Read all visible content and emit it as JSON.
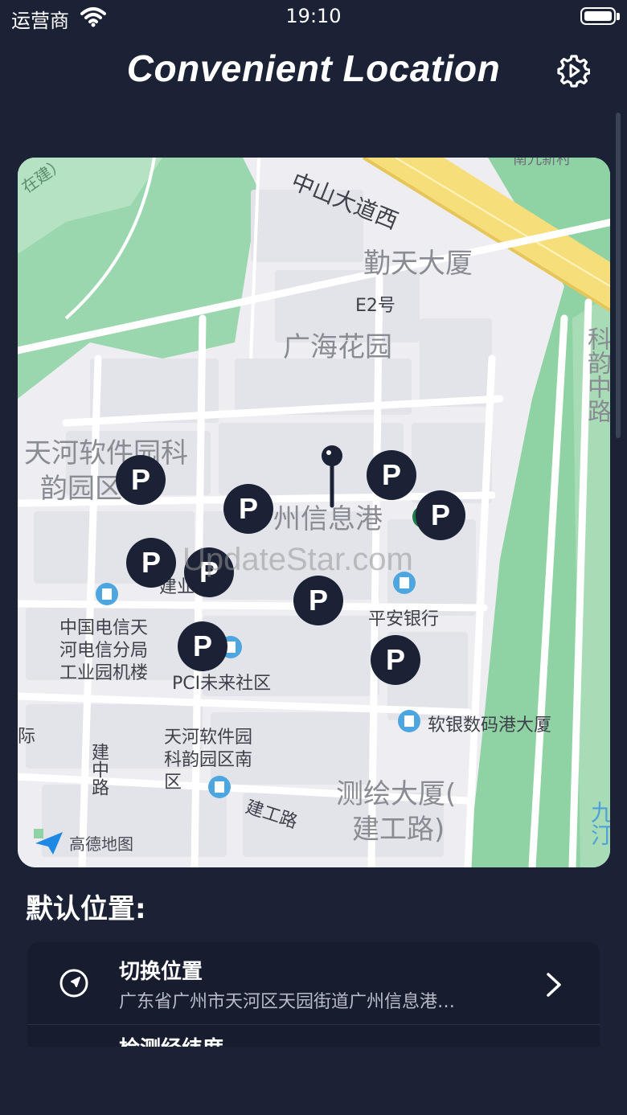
{
  "status": {
    "carrier": "运营商",
    "time": "19:10"
  },
  "header": {
    "title": "Convenient Location"
  },
  "map": {
    "labels": {
      "road_zhongshan": "中山大道西",
      "jintian": "勤天大厦",
      "e2": "E2号",
      "guanghai": "广海花园",
      "keyun_road": "科韵中路",
      "tianhe_park_1": "天河软件园科",
      "tianhe_park_2": "韵园区",
      "xinxigang": "州信息港",
      "watermark": "UpdateStar.com",
      "jianye": "建业路",
      "pingan": "平安银行",
      "telecom": "中国电信天河电信分局工业园机楼",
      "pci": "PCI未来社区",
      "ruanyin": "软银数码港大厦",
      "guoji": "际",
      "jianzhong": "建中路",
      "south_park": "天河软件园科韵园区南区",
      "jiangong": "建工路",
      "cehui_1": "测绘大厦(",
      "cehui_2": "建工路)",
      "zaijian": "在建）",
      "top_right": "南九新村",
      "right_edge": "九汀",
      "amap": "高德地图"
    },
    "parking_label": "P"
  },
  "default_location": {
    "title": "默认位置:",
    "switch_title": "切换位置",
    "switch_address": "广东省广州市天河区天园街道广州信息港…",
    "detect_title": "检测经纬度"
  },
  "colors": {
    "background": "#1b2236",
    "card": "#171d2e",
    "map_green": "#8fd3a5",
    "road_yellow": "#f6df7a"
  },
  "icons": [
    "wifi-icon",
    "battery-icon",
    "settings-icon",
    "location-pin-icon",
    "parking-icon",
    "navigation-icon",
    "chevron-right-icon",
    "amap-logo-icon"
  ]
}
